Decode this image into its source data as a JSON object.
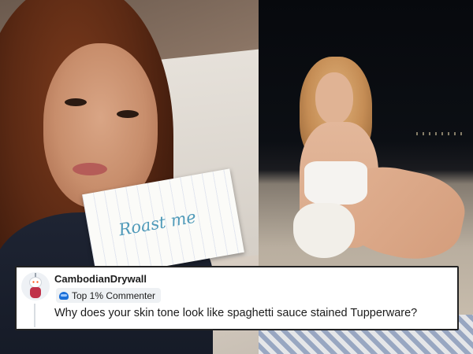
{
  "left_photo": {
    "sign_text": "Roast me"
  },
  "comment": {
    "avatar_icon": "snoo-avatar-icon",
    "username": "CambodianDrywall",
    "flair_icon": "commenter-badge-icon",
    "flair_text": "Top 1% Commenter",
    "body": "Why does your skin tone look like spaghetti sauce stained Tupperware?"
  },
  "colors": {
    "username": "#1c1c1c",
    "flair_bg": "#eef1f4",
    "flair_icon": "#1a6fd8",
    "sign_ink": "#4f9ab9"
  }
}
